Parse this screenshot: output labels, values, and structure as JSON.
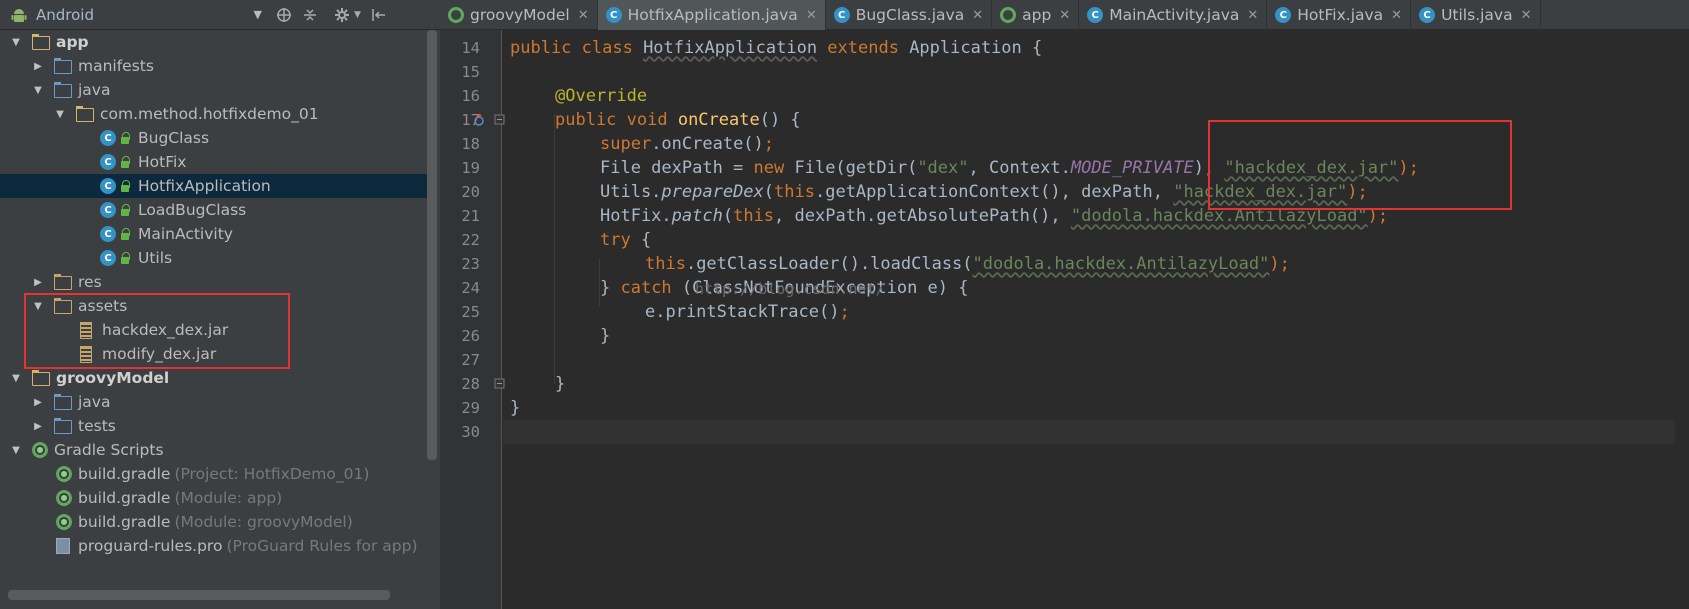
{
  "project_panel": {
    "view_selector": "Android",
    "tree": [
      {
        "label": "app",
        "bold": true,
        "level": 0,
        "expanded": true,
        "icon": "module-folder-icon"
      },
      {
        "label": "manifests",
        "level": 1,
        "expanded": false,
        "icon": "folder-icon"
      },
      {
        "label": "java",
        "level": 1,
        "expanded": true,
        "icon": "folder-icon"
      },
      {
        "label": "com.method.hotfixdemo_01",
        "level": 2,
        "expanded": true,
        "icon": "package-icon"
      },
      {
        "label": "BugClass",
        "level": 3,
        "icon": "class-icon"
      },
      {
        "label": "HotFix",
        "level": 3,
        "icon": "class-icon"
      },
      {
        "label": "HotfixApplication",
        "level": 3,
        "icon": "class-icon",
        "selected": true
      },
      {
        "label": "LoadBugClass",
        "level": 3,
        "icon": "class-icon"
      },
      {
        "label": "MainActivity",
        "level": 3,
        "icon": "class-icon"
      },
      {
        "label": "Utils",
        "level": 3,
        "icon": "class-icon"
      },
      {
        "label": "res",
        "level": 1,
        "expanded": false,
        "icon": "res-folder-icon"
      },
      {
        "label": "assets",
        "level": 1,
        "expanded": true,
        "icon": "assets-folder-icon"
      },
      {
        "label": "hackdex_dex.jar",
        "level": 2,
        "icon": "jar-icon"
      },
      {
        "label": "modify_dex.jar",
        "level": 2,
        "icon": "jar-icon"
      },
      {
        "label": "groovyModel",
        "bold": true,
        "level": 0,
        "expanded": true,
        "icon": "module-folder-icon"
      },
      {
        "label": "java",
        "level": 1,
        "expanded": false,
        "icon": "folder-icon"
      },
      {
        "label": "tests",
        "level": 1,
        "expanded": false,
        "icon": "folder-icon"
      },
      {
        "label": "Gradle Scripts",
        "level": 0,
        "expanded": true,
        "icon": "gradle-icon"
      },
      {
        "label": "build.gradle",
        "hint": "(Project: HotfixDemo_01)",
        "level": 1,
        "icon": "gradle-icon"
      },
      {
        "label": "build.gradle",
        "hint": "(Module: app)",
        "level": 1,
        "icon": "gradle-icon"
      },
      {
        "label": "build.gradle",
        "hint": "(Module: groovyModel)",
        "level": 1,
        "icon": "gradle-icon"
      },
      {
        "label": "proguard-rules.pro",
        "hint": "(ProGuard Rules for app)",
        "level": 1,
        "icon": "file-icon"
      }
    ]
  },
  "tabs": [
    {
      "label": "groovyModel",
      "icon": "module-icon",
      "active": false
    },
    {
      "label": "HotfixApplication.java",
      "icon": "class-icon",
      "active": true
    },
    {
      "label": "BugClass.java",
      "icon": "class-icon",
      "active": false
    },
    {
      "label": "app",
      "icon": "module-icon",
      "active": false
    },
    {
      "label": "MainActivity.java",
      "icon": "class-icon",
      "active": false
    },
    {
      "label": "HotFix.java",
      "icon": "class-icon",
      "active": false
    },
    {
      "label": "Utils.java",
      "icon": "class-icon",
      "active": false
    }
  ],
  "editor": {
    "line_numbers": [
      "14",
      "15",
      "16",
      "17",
      "18",
      "19",
      "20",
      "21",
      "22",
      "23",
      "24",
      "25",
      "26",
      "27",
      "28",
      "29",
      "30"
    ],
    "code": {
      "l14": [
        "public class ",
        "HotfixApplication",
        " extends ",
        "Application {"
      ],
      "l16": "@Override",
      "l17": [
        "public void ",
        "onCreate",
        "() {"
      ],
      "l18": [
        "super",
        ".onCreate()",
        ";"
      ],
      "l19": [
        "File dexPath = ",
        "new ",
        "File(getDir(",
        "\"dex\"",
        ", Context.",
        "MODE_PRIVATE",
        "), ",
        "\"hackdex_dex.jar\"",
        ");"
      ],
      "l20": [
        "Utils.",
        "prepareDex",
        "(",
        "this",
        ".getApplicationContext(), dexPath, ",
        "\"hackdex_dex.jar\"",
        ");"
      ],
      "l21": [
        "HotFix.",
        "patch",
        "(",
        "this",
        ", dexPath.getAbsolutePath(), ",
        "\"dodola.hackdex.AntilazyLoad\"",
        ");"
      ],
      "l22": [
        "try ",
        "{"
      ],
      "l23": [
        "this",
        ".getClassLoader().loadClass(",
        "\"dodola.hackdex.AntilazyLoad\"",
        ");"
      ],
      "l24": [
        "} ",
        "catch ",
        "(ClassNotFoundException e) {"
      ],
      "l25": [
        "e.printStackTrace()",
        ";"
      ],
      "l26": "}",
      "l28": "}",
      "l29": "}"
    },
    "watermark": "http://blog.csdn.net/"
  }
}
